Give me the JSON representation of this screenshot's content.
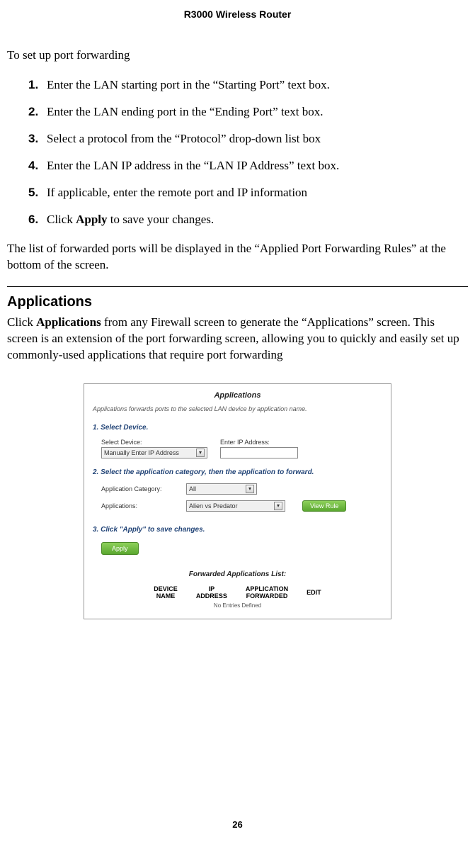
{
  "header": "R3000 Wireless Router",
  "intro": "To set up port forwarding",
  "steps": [
    {
      "num": "1.",
      "text": "Enter the LAN starting port in the “Starting Port” text box."
    },
    {
      "num": "2.",
      "text": "Enter the LAN ending port in the “Ending Port” text box."
    },
    {
      "num": "3.",
      "text": "Select a protocol from the “Protocol” drop-down list box"
    },
    {
      "num": "4.",
      "text": "Enter the LAN IP address in the “LAN IP Address” text box."
    },
    {
      "num": "5.",
      "text": "If applicable, enter the remote port and IP information"
    },
    {
      "num": "6.",
      "pre": "Click ",
      "bold": "Apply",
      "post": " to save your changes."
    }
  ],
  "para_after_steps": "The list of forwarded ports will be displayed in the “Applied Port Forwarding Rules” at the bottom of the screen.",
  "sec_heading": "Applications",
  "sec_para": {
    "pre": "Click ",
    "bold": "Applications",
    "post": " from any Firewall screen to generate the “Applications” screen. This screen is an extension of the port forwarding screen, allowing you to quickly and easily set up commonly-used applications that require port forwarding"
  },
  "panel": {
    "title": "Applications",
    "desc": "Applications forwards ports to the selected LAN device by application name.",
    "step1_label": "1. Select Device.",
    "select_device_label": "Select Device:",
    "select_device_value": "Manually Enter IP Address",
    "enter_ip_label": "Enter IP Address:",
    "enter_ip_value": "",
    "step2_label": "2. Select the application category, then the application to forward.",
    "app_category_label": "Application Category:",
    "app_category_value": "All",
    "applications_label": "Applications:",
    "applications_value": "Alien vs Predator",
    "view_rule_label": "View Rule",
    "step3_label": "3. Click \"Apply\" to save changes.",
    "apply_label": "Apply",
    "fwd_list_title": "Forwarded Applications List:",
    "tbl": {
      "h1a": "DEVICE",
      "h1b": "NAME",
      "h2a": "IP",
      "h2b": "ADDRESS",
      "h3a": "APPLICATION",
      "h3b": "FORWARDED",
      "h4": "EDIT"
    },
    "no_entries": "No Entries Defined"
  },
  "page_number": "26"
}
